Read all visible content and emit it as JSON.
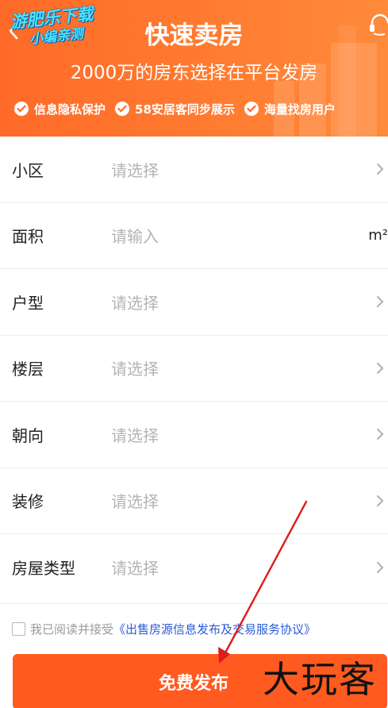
{
  "header": {
    "title": "快速卖房",
    "subtitle": "2000万的房东选择在平台发房",
    "features": [
      "信息隐私保护",
      "58安居客同步展示",
      "海量找房用户"
    ],
    "watermark": {
      "line1": "游肥乐下载",
      "line2": "小编亲测"
    },
    "back_icon": "chevron-left-icon",
    "service_icon": "headset-icon"
  },
  "form": {
    "rows": [
      {
        "label": "小区",
        "value": "请选择",
        "trailing": "chevron-right-icon"
      },
      {
        "label": "面积",
        "value": "请输入",
        "unit": "m²"
      },
      {
        "label": "户型",
        "value": "请选择",
        "trailing": "chevron-right-icon"
      },
      {
        "label": "楼层",
        "value": "请选择",
        "trailing": "chevron-right-icon"
      },
      {
        "label": "朝向",
        "value": "请选择",
        "trailing": "chevron-right-icon"
      },
      {
        "label": "装修",
        "value": "请选择",
        "trailing": "chevron-right-icon"
      },
      {
        "label": "房屋类型",
        "value": "请选择",
        "trailing": "chevron-right-icon"
      }
    ]
  },
  "agreement": {
    "prefix": "我已阅读并接受",
    "link": "《出售房源信息发布及交易服务协议》",
    "checked": false
  },
  "submit": {
    "label": "免费发布"
  },
  "watermark_bottom": "大玩客",
  "colors": {
    "accent": "#ff5a1f",
    "header": "#ff7a30",
    "link": "#2a5bd7",
    "annotation": "#e11a1a"
  }
}
